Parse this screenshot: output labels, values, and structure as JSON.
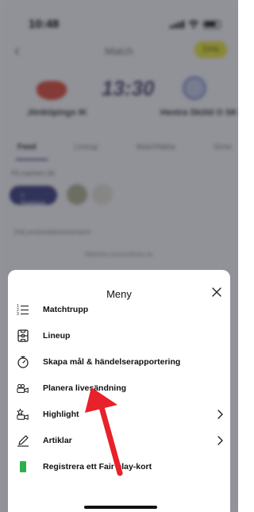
{
  "status_bar": {
    "time": "10:48"
  },
  "nav": {
    "title": "Match",
    "action_label": "Dela"
  },
  "match": {
    "time": "13:30",
    "home_team": "Jönköpings IK",
    "away_team": "Hestra Sköld O SK"
  },
  "tabs": [
    {
      "label": "Feed",
      "active": true
    },
    {
      "label": "Lineup",
      "active": false
    },
    {
      "label": "Matchfakta",
      "active": false
    },
    {
      "label": "Serie",
      "active": false
    }
  ],
  "background": {
    "section_label": "På matchen (8)",
    "pill_label": "+ Spelare",
    "collapse_label": "Dölj användarkommentarer",
    "section_note": "Matchen presenteras av"
  },
  "sheet": {
    "title": "Meny",
    "items": [
      {
        "label": "Matchtrupp",
        "icon": "numbered-list-icon",
        "has_chevron": false
      },
      {
        "label": "Lineup",
        "icon": "lineup-field-icon",
        "has_chevron": false
      },
      {
        "label": "Skapa mål & händelserapportering",
        "icon": "stopwatch-icon",
        "has_chevron": false
      },
      {
        "label": "Planera livesändning",
        "icon": "live-camera-icon",
        "has_chevron": false
      },
      {
        "label": "Highlight",
        "icon": "highlight-camera-icon",
        "has_chevron": true
      },
      {
        "label": "Artiklar",
        "icon": "pencil-icon",
        "has_chevron": true
      },
      {
        "label": "Registrera ett Fair play-kort",
        "icon": "green-card-icon",
        "has_chevron": false
      }
    ]
  },
  "colors": {
    "annotation_arrow": "#e8212a",
    "fair_play_card": "#2eae4e",
    "accent_pill": "#4a4f8a"
  }
}
